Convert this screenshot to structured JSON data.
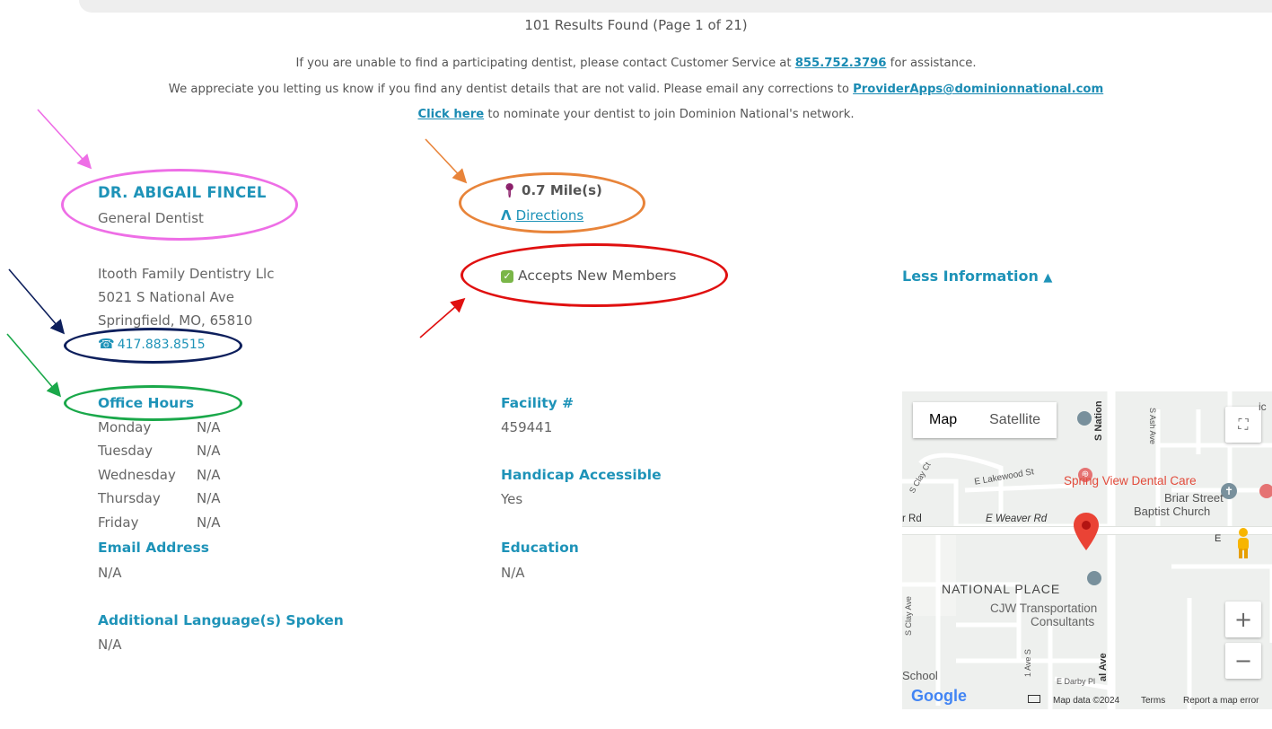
{
  "results": {
    "title": "101 Results Found (Page 1 of 21)"
  },
  "notices": {
    "line1_pre": "If you are unable to find a participating dentist, please contact Customer Service at ",
    "line1_link": "855.752.3796",
    "line1_post": " for assistance.",
    "line2_pre": "We appreciate you letting us know if you find any dentist details that are not valid. Please email any corrections to ",
    "line2_link": "ProviderApps@dominionnational.com",
    "line3_link": "Click here",
    "line3_post": " to nominate your dentist to join Dominion National's network."
  },
  "provider": {
    "name": "DR. ABIGAIL FINCEL",
    "specialty": "General Dentist",
    "practice": "Itooth Family Dentistry Llc",
    "address1": "5021 S National Ave",
    "address2": "Springfield, MO, 65810",
    "phone": "417.883.8515",
    "distance": "0.7 Mile(s)",
    "directions": "Directions",
    "accepts": "Accepts New Members",
    "less_info": "Less Information"
  },
  "office_hours": {
    "heading": "Office Hours",
    "days": [
      {
        "day": "Monday",
        "value": "N/A"
      },
      {
        "day": "Tuesday",
        "value": "N/A"
      },
      {
        "day": "Wednesday",
        "value": "N/A"
      },
      {
        "day": "Thursday",
        "value": "N/A"
      },
      {
        "day": "Friday",
        "value": "N/A"
      }
    ]
  },
  "details": {
    "email_h": "Email Address",
    "email_v": "N/A",
    "lang_h": "Additional Language(s) Spoken",
    "lang_v": "N/A",
    "facility_h": "Facility #",
    "facility_v": "459441",
    "handicap_h": "Handicap Accessible",
    "handicap_v": "Yes",
    "education_h": "Education",
    "education_v": "N/A"
  },
  "map": {
    "map_btn": "Map",
    "satellite_btn": "Satellite",
    "places": {
      "spring_view": "Spring View Dental Care",
      "briar1": "Briar Street",
      "briar2": "Baptist Church",
      "national": "NATIONAL PLACE",
      "cjw1": "CJW Transportation",
      "cjw2": "Consultants",
      "school": "School",
      "e_weaver": "E Weaver Rd",
      "r_rd": "r Rd",
      "e_lakewood": "E Lakewood St",
      "s_nation": "S Nation",
      "s_ash": "S Ash Ave",
      "s_clay_ct": "S Clay Ct",
      "s_clay_ave": "S Clay Ave",
      "e_darby": "E Darby Pl",
      "al_ave": "al Ave",
      "ave_s": "1 Ave S",
      "e_label": "E",
      "ic_label": "ic"
    },
    "footer": {
      "google": "Google",
      "map_data": "Map data ©2024",
      "terms": "Terms",
      "report": "Report a map error"
    },
    "zoom_in": "+",
    "zoom_out": "−"
  },
  "colors": {
    "accent": "#1e93b8",
    "text": "#555555",
    "pin": "#8b1f6a",
    "check": "#7ab648",
    "annotation_pink": "#ee6ee6",
    "annotation_orange": "#e8843a",
    "annotation_red": "#e01010",
    "annotation_navy": "#0d1f5c",
    "annotation_green": "#1aa84a"
  }
}
